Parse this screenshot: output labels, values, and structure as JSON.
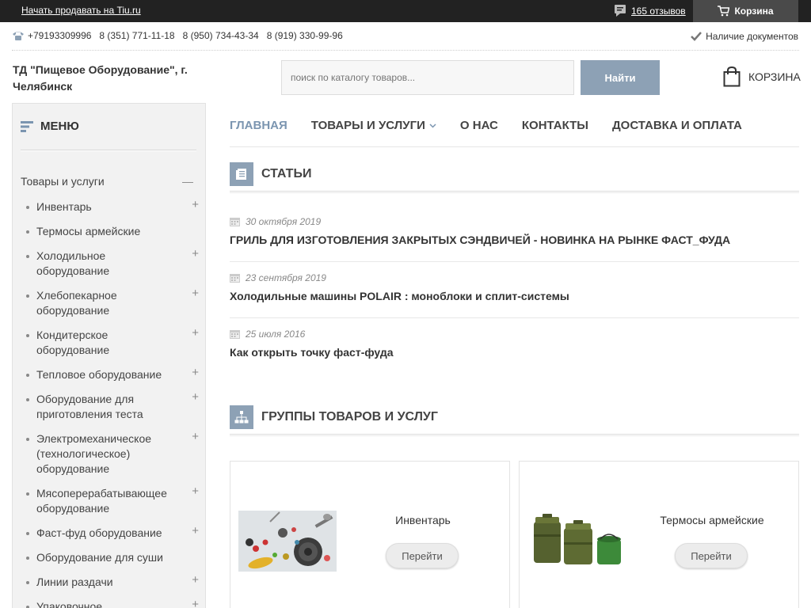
{
  "topbar": {
    "sell_link": "Начать продавать на Tiu.ru",
    "reviews": "165 отзывов",
    "cart": "Корзина"
  },
  "contacts": {
    "phones": [
      "+79193309996",
      "8 (351) 771-11-18",
      "8 (950) 734-43-34",
      "8 (919) 330-99-96"
    ],
    "docs": "Наличие документов"
  },
  "header": {
    "company": "ТД \"Пищевое Оборудование\", г. Челябинск",
    "search_placeholder": "поиск по каталогу товаров...",
    "search_button": "Найти",
    "cart_label": "КОРЗИНА"
  },
  "sidebar": {
    "title": "МЕНЮ",
    "root": "Товары и услуги",
    "items": [
      {
        "label": "Инвентарь",
        "expandable": true
      },
      {
        "label": "Термосы армейские",
        "expandable": false
      },
      {
        "label": "Холодильное оборудование",
        "expandable": true
      },
      {
        "label": "Хлебопекарное оборудование",
        "expandable": true
      },
      {
        "label": "Кондитерское оборудование",
        "expandable": true
      },
      {
        "label": "Тепловое оборудование",
        "expandable": true
      },
      {
        "label": "Оборудование для приготовления теста",
        "expandable": true
      },
      {
        "label": "Электромеханическое (технологическое) оборудование",
        "expandable": true
      },
      {
        "label": "Мясоперерабатывающее оборудование",
        "expandable": true
      },
      {
        "label": "Фаст-фуд оборудование",
        "expandable": true
      },
      {
        "label": "Оборудование для суши",
        "expandable": false
      },
      {
        "label": "Линии раздачи",
        "expandable": true
      },
      {
        "label": "Упаковочное",
        "expandable": true
      }
    ]
  },
  "nav": [
    {
      "label": "ГЛАВНАЯ",
      "active": true
    },
    {
      "label": "ТОВАРЫ И УСЛУГИ",
      "dropdown": true
    },
    {
      "label": "О НАС"
    },
    {
      "label": "КОНТАКТЫ"
    },
    {
      "label": "ДОСТАВКА И ОПЛАТА"
    }
  ],
  "articles": {
    "title": "СТАТЬИ",
    "items": [
      {
        "date": "30 октября 2019",
        "title": "ГРИЛЬ ДЛЯ ИЗГОТОВЛЕНИЯ ЗАКРЫТЫХ СЭНДВИЧЕЙ - НОВИНКА НА РЫНКЕ ФАСТ_ФУДА"
      },
      {
        "date": "23 сентября 2019",
        "title": "Холодильные машины POLAIR : моноблоки и сплит-системы"
      },
      {
        "date": "25 июля 2016",
        "title": "Как открыть точку фаст-фуда"
      }
    ]
  },
  "groups": {
    "title": "ГРУППЫ ТОВАРОВ И УСЛУГ",
    "cards": [
      {
        "name": "Инвентарь",
        "button": "Перейти"
      },
      {
        "name": "Термосы армейские",
        "button": "Перейти"
      }
    ]
  },
  "colors": {
    "accent": "#8da1b5",
    "topbar": "#222222",
    "nav_active": "#7b95b0"
  }
}
